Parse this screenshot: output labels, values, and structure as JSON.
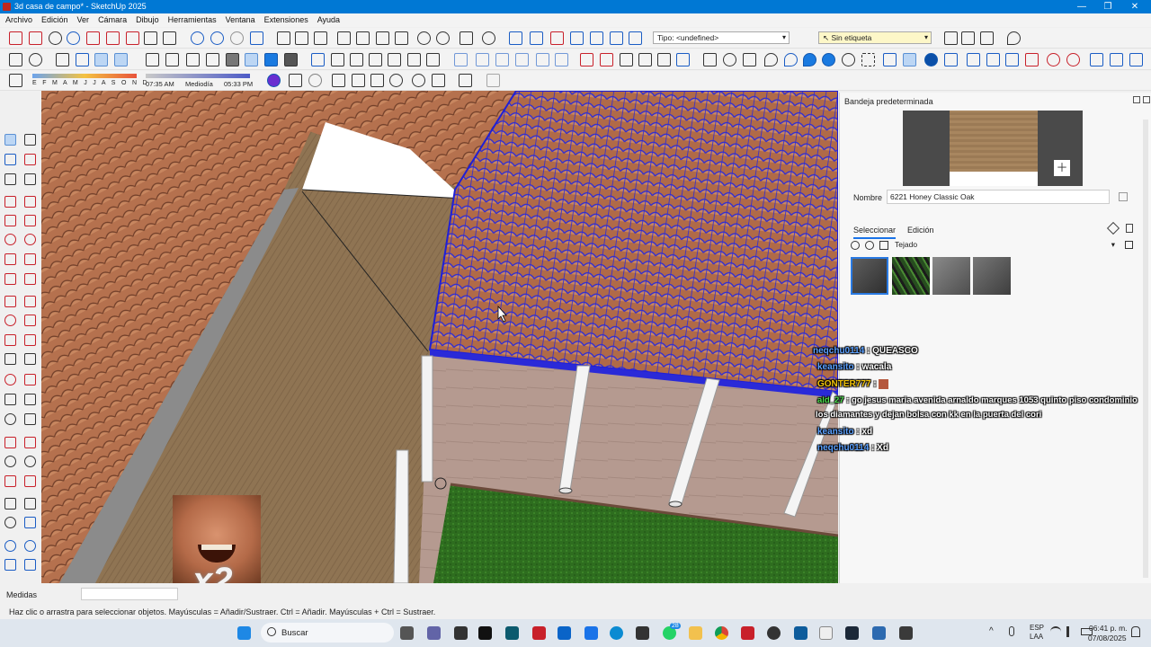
{
  "window": {
    "title": "3d casa de campo* - SketchUp 2025",
    "minimize": "—",
    "maximize": "❐",
    "close": "✕"
  },
  "menu": [
    "Archivo",
    "Edición",
    "Ver",
    "Cámara",
    "Dibujo",
    "Herramientas",
    "Ventana",
    "Extensiones",
    "Ayuda"
  ],
  "toolbar": {
    "tipo_label": "Tipo: <undefined>",
    "tag_label": "Sin etiqueta",
    "shadow_months": "E F M A M J J A S O N D",
    "shadow_time_start": "07:35 AM",
    "shadow_time_mid": "Mediodía",
    "shadow_time_end": "05:33 PM"
  },
  "tray": {
    "title": "Bandeja predeterminada",
    "nombre_label": "Nombre",
    "material_name": "6221 Honey Classic Oak",
    "tab_select": "Seleccionar",
    "tab_edit": "Edición",
    "library": "Tejado",
    "swatches": [
      "dark-gray-tile",
      "green-tile",
      "gray-tile",
      "stone-tile"
    ]
  },
  "chat": [
    {
      "user": "neqchu0114",
      "msg": ": QUEASCO"
    },
    {
      "user": "keansito",
      "msg": ": wacala"
    },
    {
      "user": "GONTER777",
      "msg": ":"
    },
    {
      "user": "ald_27",
      "msg": ": go jesus maria avenida arnaldo marques 1053 quinto piso condominio"
    },
    {
      "user": "",
      "msg": "los diamantes y dejan bolsa con kk en la puerta del cori"
    },
    {
      "user": "keansito",
      "msg": ": xd"
    },
    {
      "user": "neqchu0114",
      "msg": ": Xd"
    }
  ],
  "overlay": {
    "multiplier": "x2"
  },
  "measure_label": "Medidas",
  "status_text": "Haz clic o arrastra para seleccionar objetos. Mayúsculas = Añadir/Sustraer. Ctrl = Añadir. Mayúsculas + Ctrl = Sustraer.",
  "taskbar": {
    "search": "Buscar",
    "badge": "28",
    "lang_top": "ESP",
    "lang_bottom": "LAA",
    "time": "06:41 p. m.",
    "date": "07/08/2025"
  },
  "colors": {
    "accent": "#0078d4",
    "selection": "#1f1fd6",
    "roof": "#b06a48",
    "floor": "#8c7152",
    "grass": "#2d6a1e"
  }
}
